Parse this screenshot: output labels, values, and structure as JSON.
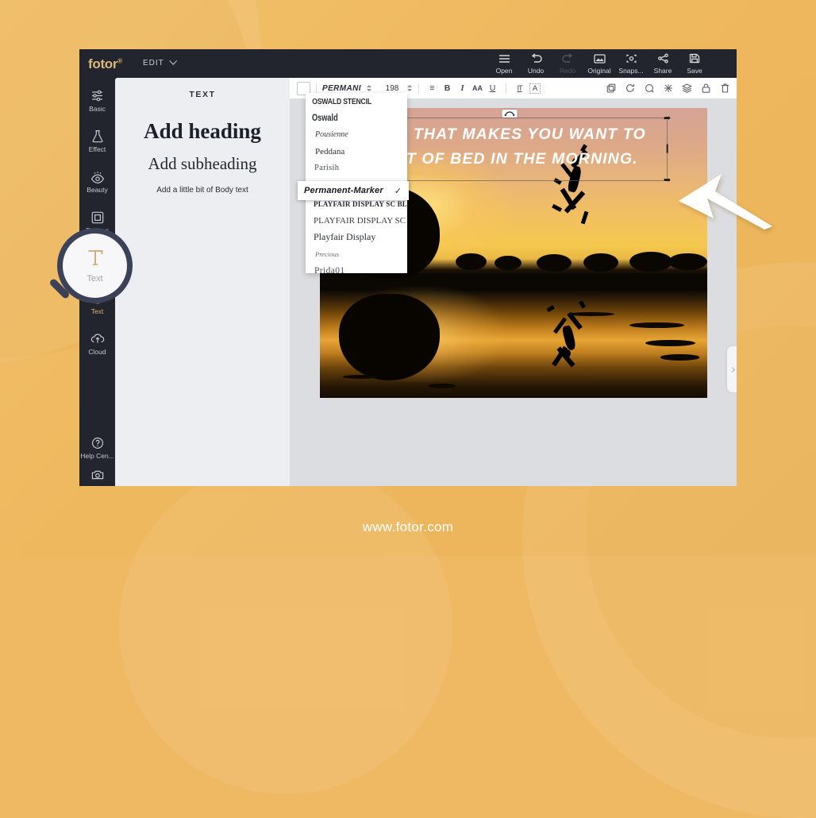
{
  "background": {
    "accent_color": "#efb963",
    "panel_dark": "#22242e",
    "brand_gold": "#d9b878"
  },
  "app": {
    "logo": "fotor",
    "logo_mark": "®",
    "edit_menu": "EDIT",
    "top_actions": [
      {
        "label": "Open",
        "icon": "hamburger-icon",
        "disabled": false
      },
      {
        "label": "Undo",
        "icon": "undo-icon",
        "disabled": false
      },
      {
        "label": "Redo",
        "icon": "redo-icon",
        "disabled": true
      },
      {
        "label": "Original",
        "icon": "image-icon",
        "disabled": false
      },
      {
        "label": "Snaps...",
        "icon": "snapshot-icon",
        "disabled": false
      },
      {
        "label": "Share",
        "icon": "share-icon",
        "disabled": false
      },
      {
        "label": "Save",
        "icon": "save-icon",
        "disabled": false
      }
    ]
  },
  "sidebar": {
    "items": [
      {
        "label": "Basic",
        "icon": "sliders-icon",
        "active": false
      },
      {
        "label": "Effect",
        "icon": "flask-icon",
        "active": false
      },
      {
        "label": "Beauty",
        "icon": "eye-icon",
        "active": false
      },
      {
        "label": "Frames",
        "icon": "frame-icon",
        "active": false
      },
      {
        "label": "",
        "icon": "sticker-icon",
        "active": false
      },
      {
        "label": "Text",
        "icon": "text-t-icon",
        "active": true
      },
      {
        "label": "Cloud",
        "icon": "cloud-upload-icon",
        "active": false
      }
    ],
    "bottom_items": [
      {
        "label": "Help Cen...",
        "icon": "question-circle-icon"
      },
      {
        "label": "",
        "icon": "camera-icon"
      }
    ]
  },
  "text_panel": {
    "title": "TEXT",
    "heading": "Add heading",
    "subheading": "Add subheading",
    "body": "Add a little bit of Body text"
  },
  "format_toolbar": {
    "color_swatch": "#ffffff",
    "font_name": "PERMANI",
    "font_size": "198",
    "buttons": [
      {
        "label": "≡",
        "name": "align-button"
      },
      {
        "label": "B",
        "name": "bold-button"
      },
      {
        "label": "I",
        "name": "italic-button"
      },
      {
        "label": "AA",
        "name": "letter-case-button"
      },
      {
        "label": "U",
        "name": "underline-button"
      },
      {
        "label": "IT",
        "name": "line-spacing-button"
      },
      {
        "label": "A",
        "name": "text-outline-button"
      }
    ],
    "right_icons": [
      {
        "name": "duplicate-icon"
      },
      {
        "name": "rotate-icon"
      },
      {
        "name": "flip-icon"
      },
      {
        "name": "blend-icon"
      },
      {
        "name": "layers-icon"
      },
      {
        "name": "lock-icon"
      },
      {
        "name": "delete-icon"
      }
    ]
  },
  "font_dropdown": {
    "options": [
      {
        "label": "OSWALD STENCIL",
        "style": "f-oswald-st",
        "selected": false
      },
      {
        "label": "Oswald",
        "style": "f-oswald",
        "selected": false
      },
      {
        "label": "Pousienne",
        "style": "f-pousienne",
        "selected": false
      },
      {
        "label": "Peddana",
        "style": "f-peddana",
        "selected": false
      },
      {
        "label": "Parisih",
        "style": "f-parisih",
        "selected": false
      },
      {
        "label": "PLAYFAIR DISPLAY SC BLACK",
        "style": "f-pf-scb",
        "selected": false
      },
      {
        "label": "PLAYFAIR DISPLAY SC",
        "style": "f-pf-sc",
        "selected": false
      },
      {
        "label": "Playfair Display",
        "style": "f-pf",
        "selected": false
      },
      {
        "label": "Precious",
        "style": "f-precious",
        "selected": false
      },
      {
        "label": "Prida01",
        "style": "f-prida",
        "selected": false
      }
    ],
    "selected_option": {
      "label": "Permanent-Marker",
      "checkmark": "✓"
    }
  },
  "canvas": {
    "overlay_text_line1": "OAL THAT MAKES YOU WANT TO",
    "overlay_text_line2": "OUT OF BED IN THE MORNING.",
    "rotate_handle": "rotate-handle"
  },
  "footer": {
    "url": "www.fotor.com"
  }
}
